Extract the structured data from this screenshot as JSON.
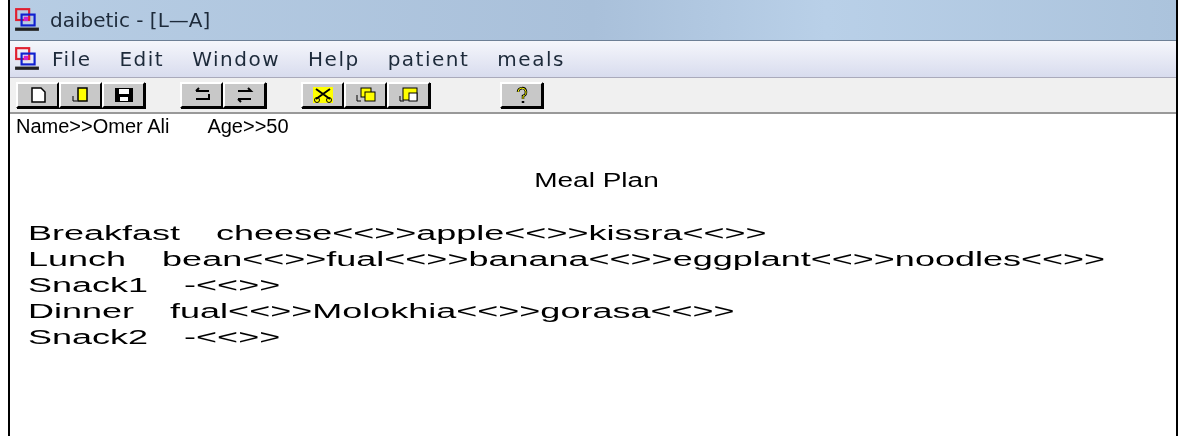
{
  "window": {
    "title": "daibetic - [L—A]"
  },
  "menu": [
    "File",
    "Edit",
    "Window",
    "Help",
    "patient",
    "meals"
  ],
  "toolbar": [
    [
      {
        "kind": "new"
      },
      {
        "kind": "open"
      },
      {
        "kind": "save"
      }
    ],
    [
      {
        "kind": "undo"
      },
      {
        "kind": "redo"
      }
    ],
    [
      {
        "kind": "cut"
      },
      {
        "kind": "copy"
      },
      {
        "kind": "paste"
      }
    ],
    [
      {
        "kind": "help"
      }
    ]
  ],
  "patient": {
    "name": "Name>>Omer Ali",
    "age": "Age>>50"
  },
  "heading": "Meal Plan",
  "meals": [
    {
      "meal": "Breakfast",
      "items": "cheese<<>>apple<<>>kissra<<>>"
    },
    {
      "meal": "Lunch",
      "items": "bean<<>>fual<<>>banana<<>>eggplant<<>>noodles<<>>"
    },
    {
      "meal": "Snack1",
      "items": "-<<>>"
    },
    {
      "meal": "Dinner",
      "items": "fual<<>>Molokhia<<>>gorasa<<>>"
    },
    {
      "meal": "Snack2",
      "items": "-<<>>"
    }
  ]
}
